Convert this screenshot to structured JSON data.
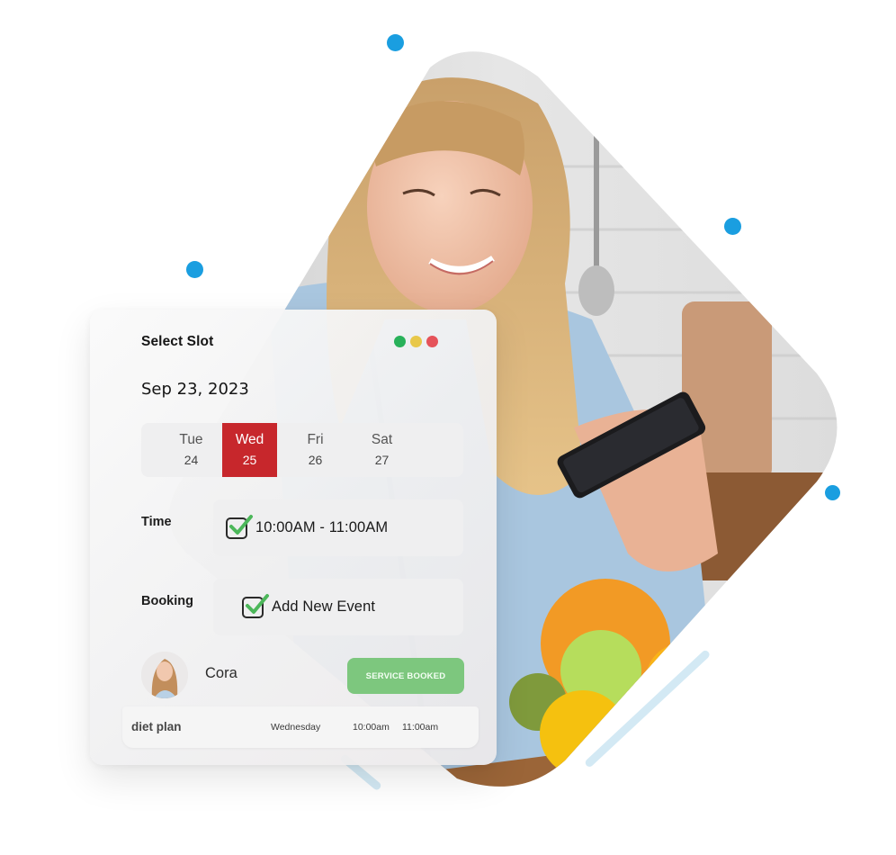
{
  "card": {
    "title": "Select Slot",
    "window_controls": [
      {
        "name": "green",
        "color": "#28b15a"
      },
      {
        "name": "yellow",
        "color": "#e8c84a"
      },
      {
        "name": "red",
        "color": "#e5535a"
      }
    ],
    "date": "Sep 23, 2023",
    "days": [
      {
        "name": "Tue",
        "number": "24",
        "selected": false
      },
      {
        "name": "Wed",
        "number": "25",
        "selected": true
      },
      {
        "name": "Fri",
        "number": "26",
        "selected": false
      },
      {
        "name": "Sat",
        "number": "27",
        "selected": false
      }
    ],
    "time": {
      "label": "Time",
      "value": "10:00AM - 11:00AM",
      "checked": true
    },
    "booking": {
      "label": "Booking",
      "value": "Add New Event",
      "checked": true
    },
    "user": {
      "name": "Cora",
      "status_button": "SERVICE BOOKED"
    },
    "plan": {
      "name": "diet plan",
      "day": "Wednesday",
      "start": "10:00am",
      "end": "11:00am"
    }
  },
  "colors": {
    "accent_red": "#c7272c",
    "check_green": "#4cb75a",
    "status_green": "#7dc77e",
    "decor_blue": "#1a9ee0",
    "decor_stripe": "#d3e9f4"
  }
}
